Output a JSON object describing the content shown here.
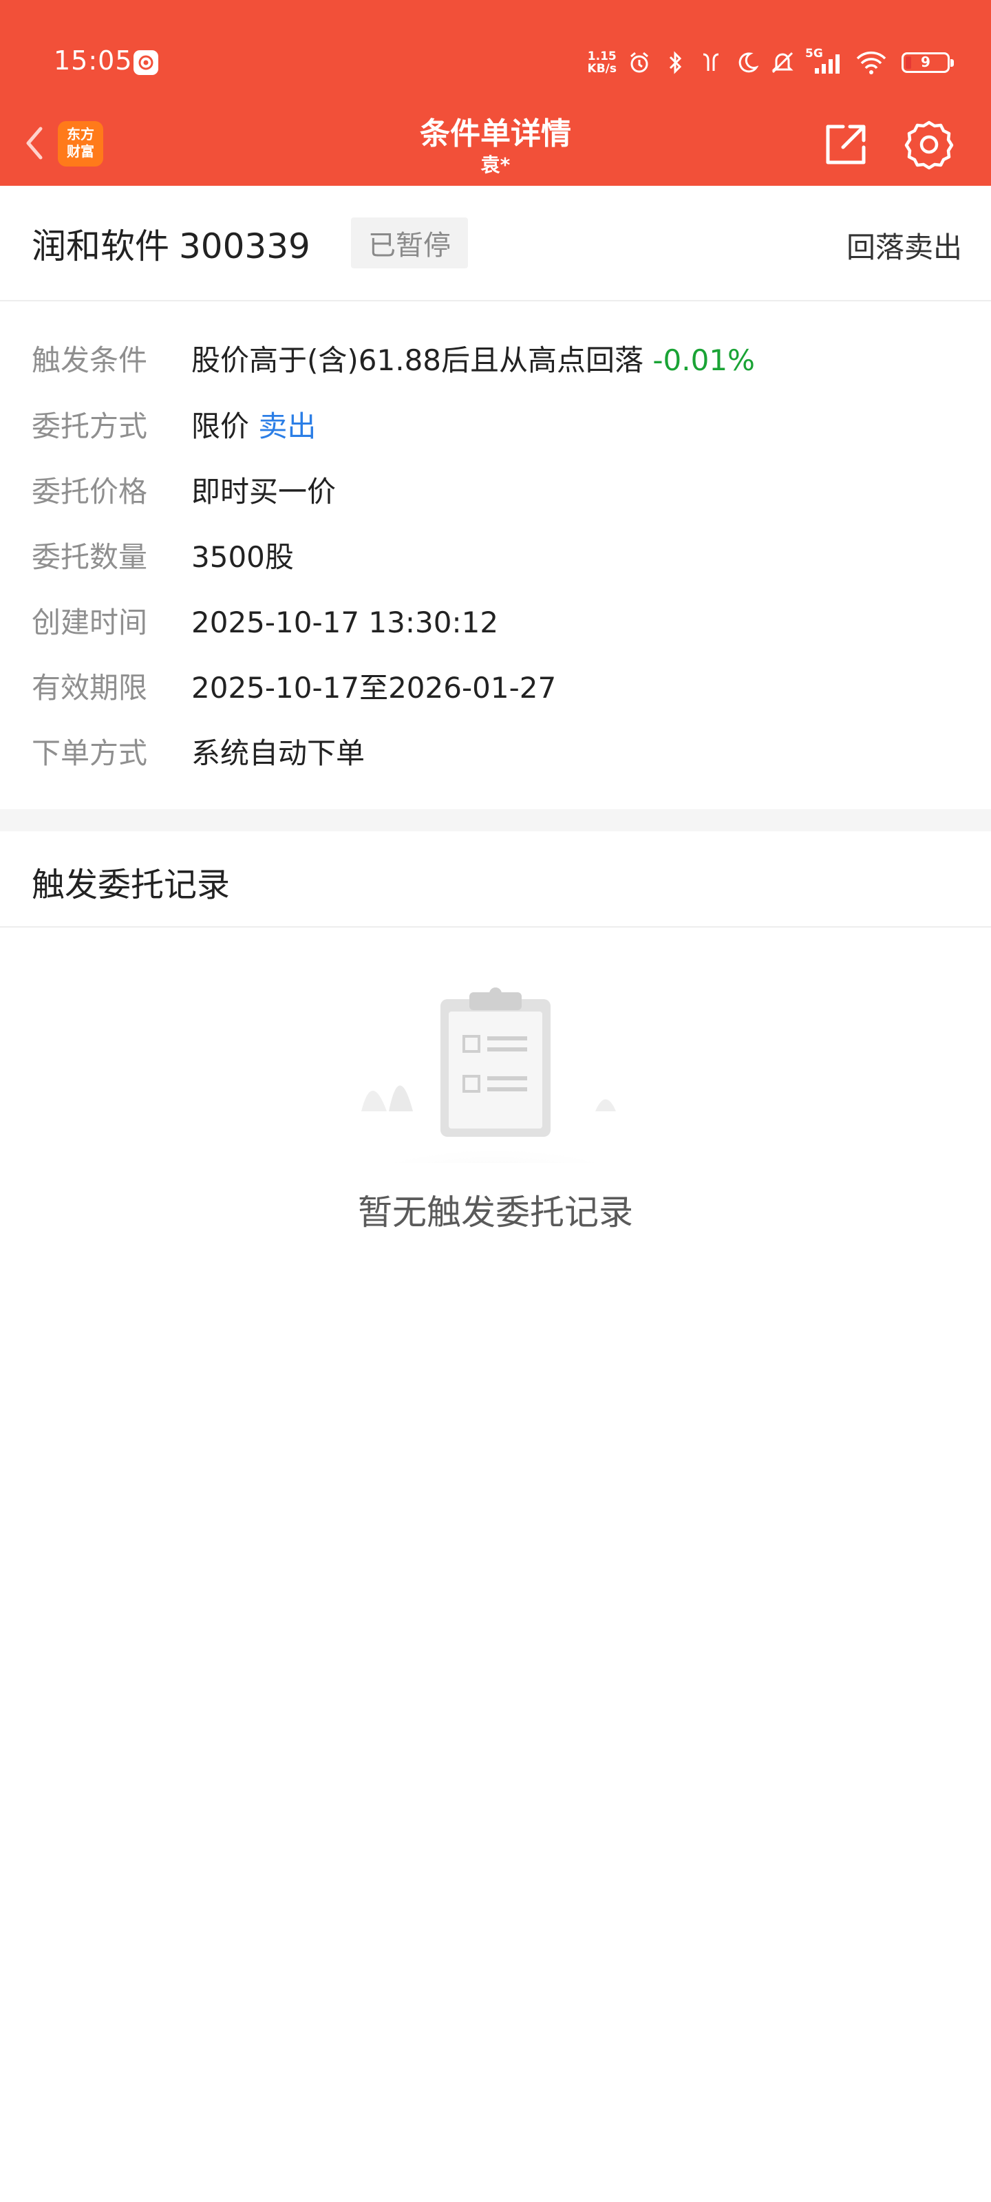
{
  "status_bar": {
    "time": "15:05",
    "net_speed_value": "1.15",
    "net_speed_unit": "KB/s",
    "signal_label": "5G",
    "battery_level": "9",
    "icons": [
      "alarm-icon",
      "bluetooth-icon",
      "earbuds-icon",
      "moon-icon",
      "mute-icon",
      "signal-icon",
      "wifi-icon",
      "battery-icon"
    ]
  },
  "nav": {
    "title": "条件单详情",
    "subtitle": "袁*",
    "brand_line1": "东方",
    "brand_line2": "财富"
  },
  "stock": {
    "name": "润和软件",
    "code": "300339",
    "status": "已暂停",
    "order_type": "回落卖出"
  },
  "details": [
    {
      "label": "触发条件",
      "value": "股价高于(含)61.88后且从高点回落",
      "highlight": "-0.01%"
    },
    {
      "label": "委托方式",
      "value": "限价",
      "highlight": "卖出"
    },
    {
      "label": "委托价格",
      "value": "即时买一价"
    },
    {
      "label": "委托数量",
      "value": "3500股"
    },
    {
      "label": "创建时间",
      "value": "2025-10-17 13:30:12"
    },
    {
      "label": "有效期限",
      "value": "2025-10-17至2026-01-27"
    },
    {
      "label": "下单方式",
      "value": "系统自动下单"
    }
  ],
  "records": {
    "title": "触发委托记录",
    "empty_text": "暂无触发委托记录"
  },
  "colors": {
    "header_bg": "#f25039",
    "positive_green": "#1aa335",
    "link_blue": "#2b7ee6",
    "badge_bg": "#f2f2f2"
  }
}
